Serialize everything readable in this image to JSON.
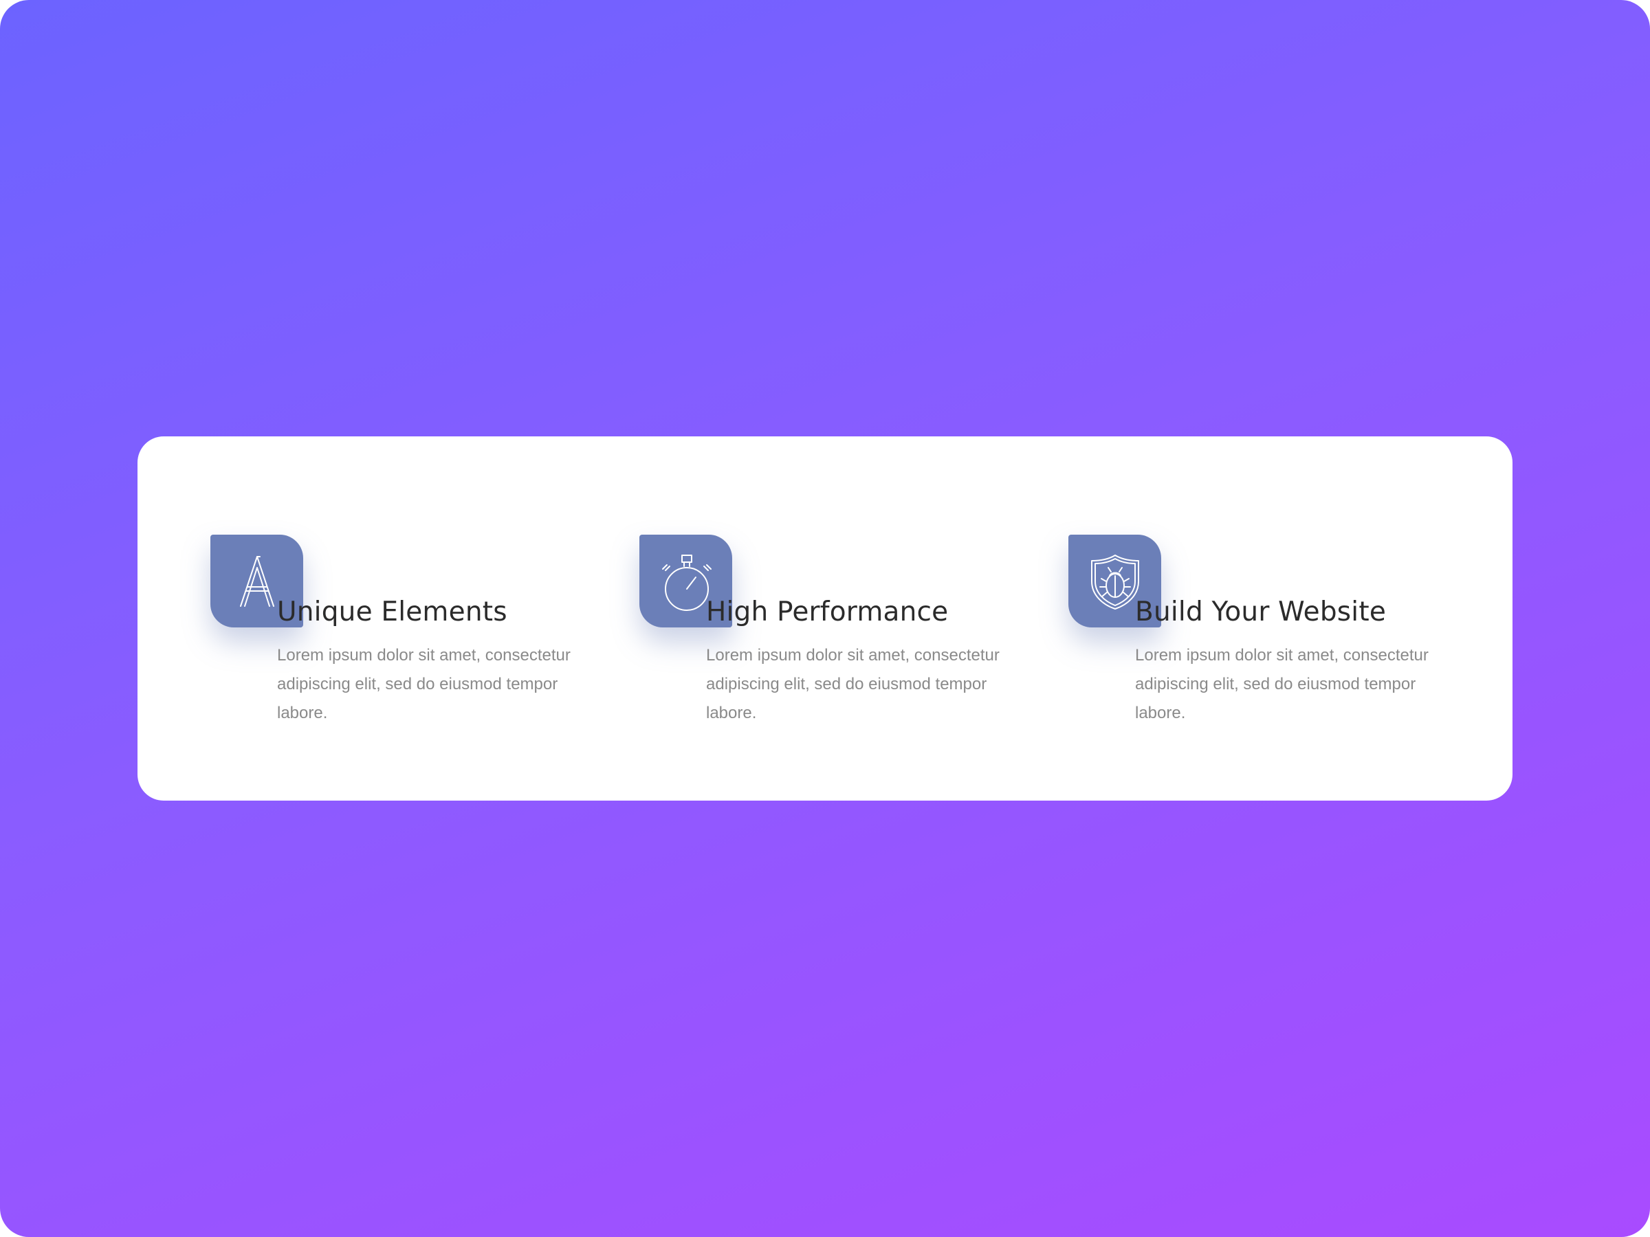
{
  "features": [
    {
      "icon": "letter-a-icon",
      "title": "Unique Elements",
      "description": "Lorem ipsum dolor sit amet, consectetur adipiscing elit, sed do eiusmod tempor labore."
    },
    {
      "icon": "stopwatch-icon",
      "title": "High Performance",
      "description": "Lorem ipsum dolor sit amet, consectetur adipiscing elit, sed do eiusmod tempor labore."
    },
    {
      "icon": "shield-bug-icon",
      "title": "Build Your Website",
      "description": "Lorem ipsum dolor sit amet, consectetur adipiscing elit, sed do eiusmod tempor labore."
    }
  ],
  "colors": {
    "background_start": "#6c63ff",
    "background_end": "#a94bff",
    "icon_box": "#6b7fb8",
    "card": "#ffffff",
    "title": "#2b2b2b",
    "description": "#8a8a8a"
  }
}
